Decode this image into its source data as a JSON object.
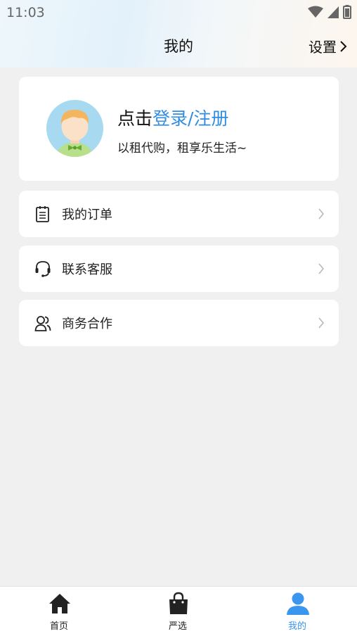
{
  "status_bar": {
    "time": "11:03"
  },
  "header": {
    "title": "我的",
    "settings_label": "设置"
  },
  "profile": {
    "login_prefix": "点击",
    "login_link": "登录/注册",
    "slogan": "以租代购，租享乐生活~"
  },
  "menu": [
    {
      "label": "我的订单",
      "icon": "clipboard-icon"
    },
    {
      "label": "联系客服",
      "icon": "headset-icon"
    },
    {
      "label": "商务合作",
      "icon": "users-icon"
    }
  ],
  "tabs": [
    {
      "label": "首页",
      "icon": "home-icon"
    },
    {
      "label": "严选",
      "icon": "shopping-bag-icon"
    },
    {
      "label": "我的",
      "icon": "user-icon",
      "active": true
    }
  ],
  "colors": {
    "accent": "#2f8de4",
    "tab_active": "#3a96ef",
    "tab_inactive": "#222222"
  }
}
